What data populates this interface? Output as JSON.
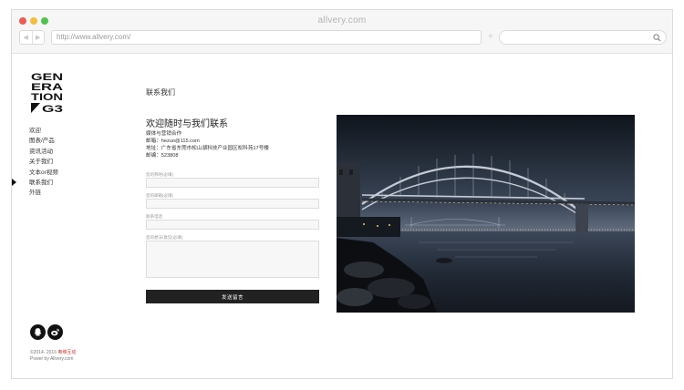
{
  "browser": {
    "window_title": "allvery.com",
    "url": "http://www.allvery.com/",
    "back_label": "◀",
    "forward_label": "▶",
    "new_tab_label": "+"
  },
  "sidebar": {
    "logo_lines": [
      "GEN",
      "ERA",
      "TION",
      "G3"
    ],
    "menu": [
      "欢迎",
      "图表/产品",
      "资讯活动",
      "关于我们",
      "文本or视频",
      "联系我们",
      "外链"
    ],
    "active_index": 5
  },
  "page": {
    "title": "联系我们",
    "heading": "欢迎随时与我们联系",
    "info_lines": [
      "媒体与营销合作",
      "邮箱：hezuo@115.com",
      "地址：广东省东莞市松山湖科技产业园区松科苑17号楼",
      "邮编：523808"
    ]
  },
  "form": {
    "name_label": "您的称呼(必填)",
    "email_label": "您的邮箱(必填)",
    "phone_label": "联系电话",
    "message_label": "您的想法/意见(必填)",
    "submit_label": "发送留言"
  },
  "footer": {
    "copyright_prefix": "©2014- 2016 ",
    "copyright_link": "奥维互动",
    "powered": "Power by Allvery.com"
  },
  "colors": {
    "accent": "#222222",
    "link": "#cc3333"
  }
}
